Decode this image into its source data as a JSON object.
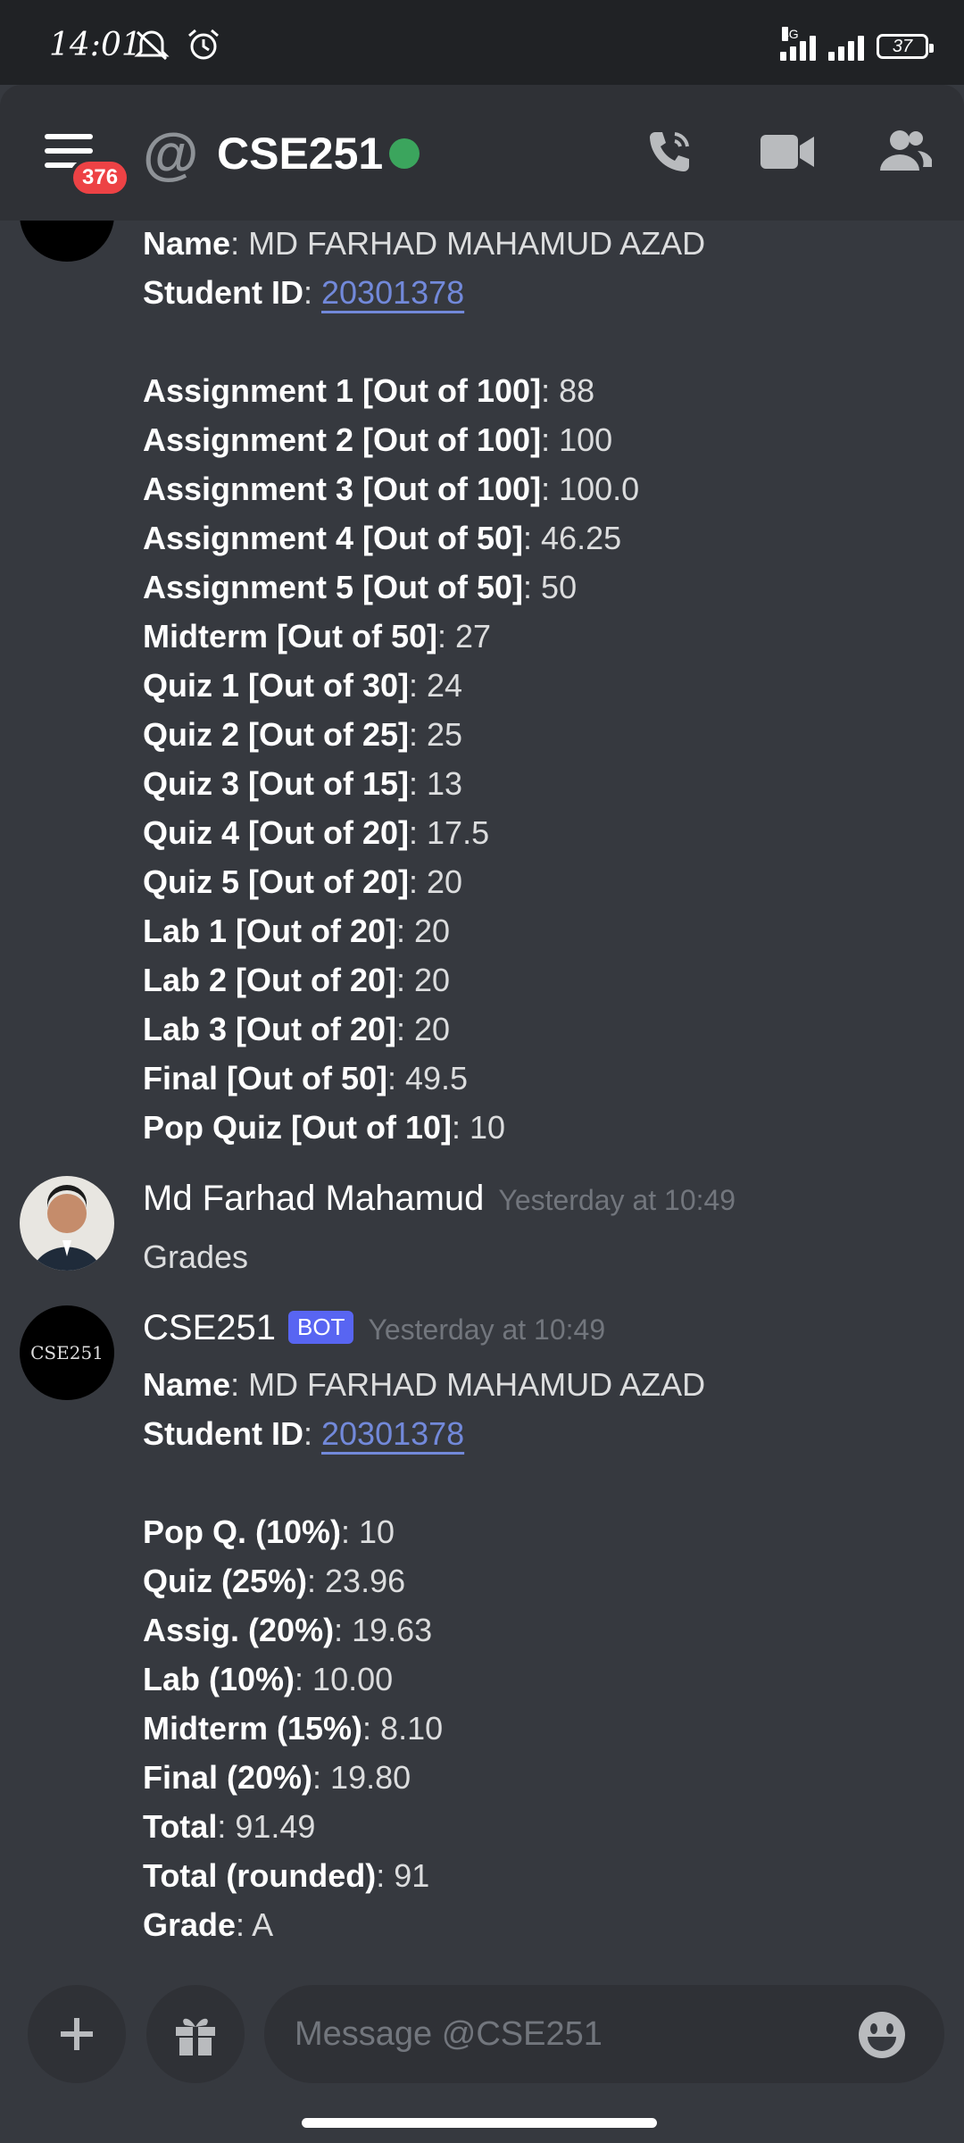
{
  "status_bar": {
    "time": "14:01",
    "network_label": "4G",
    "battery": "37"
  },
  "header": {
    "badge": "376",
    "channel": "CSE251"
  },
  "messages": {
    "bot_block_1": {
      "name_label": "Name",
      "name_value": ": MD FARHAD MAHAMUD AZAD",
      "id_label": "Student ID",
      "id_value": "20301378",
      "rows": [
        {
          "label": "Assignment 1 [Out of 100]",
          "value": ": 88"
        },
        {
          "label": "Assignment 2 [Out of 100]",
          "value": ": 100"
        },
        {
          "label": "Assignment 3 [Out of 100]",
          "value": ": 100.0"
        },
        {
          "label": "Assignment 4 [Out of 50]",
          "value": ": 46.25"
        },
        {
          "label": "Assignment 5 [Out of 50]",
          "value": ": 50"
        },
        {
          "label": "Midterm [Out of 50]",
          "value": ": 27"
        },
        {
          "label": "Quiz 1 [Out of 30]",
          "value": ": 24"
        },
        {
          "label": "Quiz 2 [Out of 25]",
          "value": ": 25"
        },
        {
          "label": "Quiz 3 [Out of 15]",
          "value": ": 13"
        },
        {
          "label": "Quiz 4 [Out of 20]",
          "value": ": 17.5"
        },
        {
          "label": "Quiz 5 [Out of 20]",
          "value": ": 20"
        },
        {
          "label": "Lab 1 [Out of 20]",
          "value": ": 20"
        },
        {
          "label": "Lab 2 [Out of 20]",
          "value": ": 20"
        },
        {
          "label": "Lab 3 [Out of 20]",
          "value": ": 20"
        },
        {
          "label": "Final [Out of 50]",
          "value": ": 49.5"
        },
        {
          "label": "Pop Quiz [Out of 10]",
          "value": ": 10"
        }
      ]
    },
    "user_message": {
      "author": "Md Farhad Mahamud",
      "timestamp": "Yesterday at 10:49",
      "text": "Grades"
    },
    "bot_message": {
      "author": "CSE251",
      "bot_tag": "BOT",
      "timestamp": "Yesterday at 10:49",
      "avatar_text": "CSE251",
      "name_label": "Name",
      "name_value": ": MD FARHAD MAHAMUD AZAD",
      "id_label": "Student ID",
      "id_value": "20301378",
      "rows": [
        {
          "label": "Pop Q. (10%)",
          "value": ": 10"
        },
        {
          "label": "Quiz (25%)",
          "value": ": 23.96"
        },
        {
          "label": "Assig. (20%)",
          "value": ": 19.63"
        },
        {
          "label": "Lab (10%)",
          "value": ": 10.00"
        },
        {
          "label": "Midterm (15%)",
          "value": ": 8.10"
        },
        {
          "label": "Final (20%)",
          "value": ": 19.80"
        },
        {
          "label": "Total",
          "value": ": 91.49"
        },
        {
          "label": "Total (rounded)",
          "value": ": 91"
        },
        {
          "label": "Grade",
          "value": ": A"
        }
      ]
    }
  },
  "composer": {
    "placeholder": "Message @CSE251"
  },
  "icons": [
    "silent-alarm-off-icon",
    "alarm-icon",
    "signal-icon",
    "battery-icon",
    "menu-icon",
    "at-icon",
    "phone-icon",
    "video-icon",
    "members-icon",
    "plus-icon",
    "gift-icon",
    "emoji-icon"
  ],
  "colors": {
    "background": "#36393f",
    "header": "#2f3136",
    "link": "#7289da",
    "bot_tag": "#5865f2",
    "online": "#3ba55d",
    "badge": "#ed4245"
  }
}
